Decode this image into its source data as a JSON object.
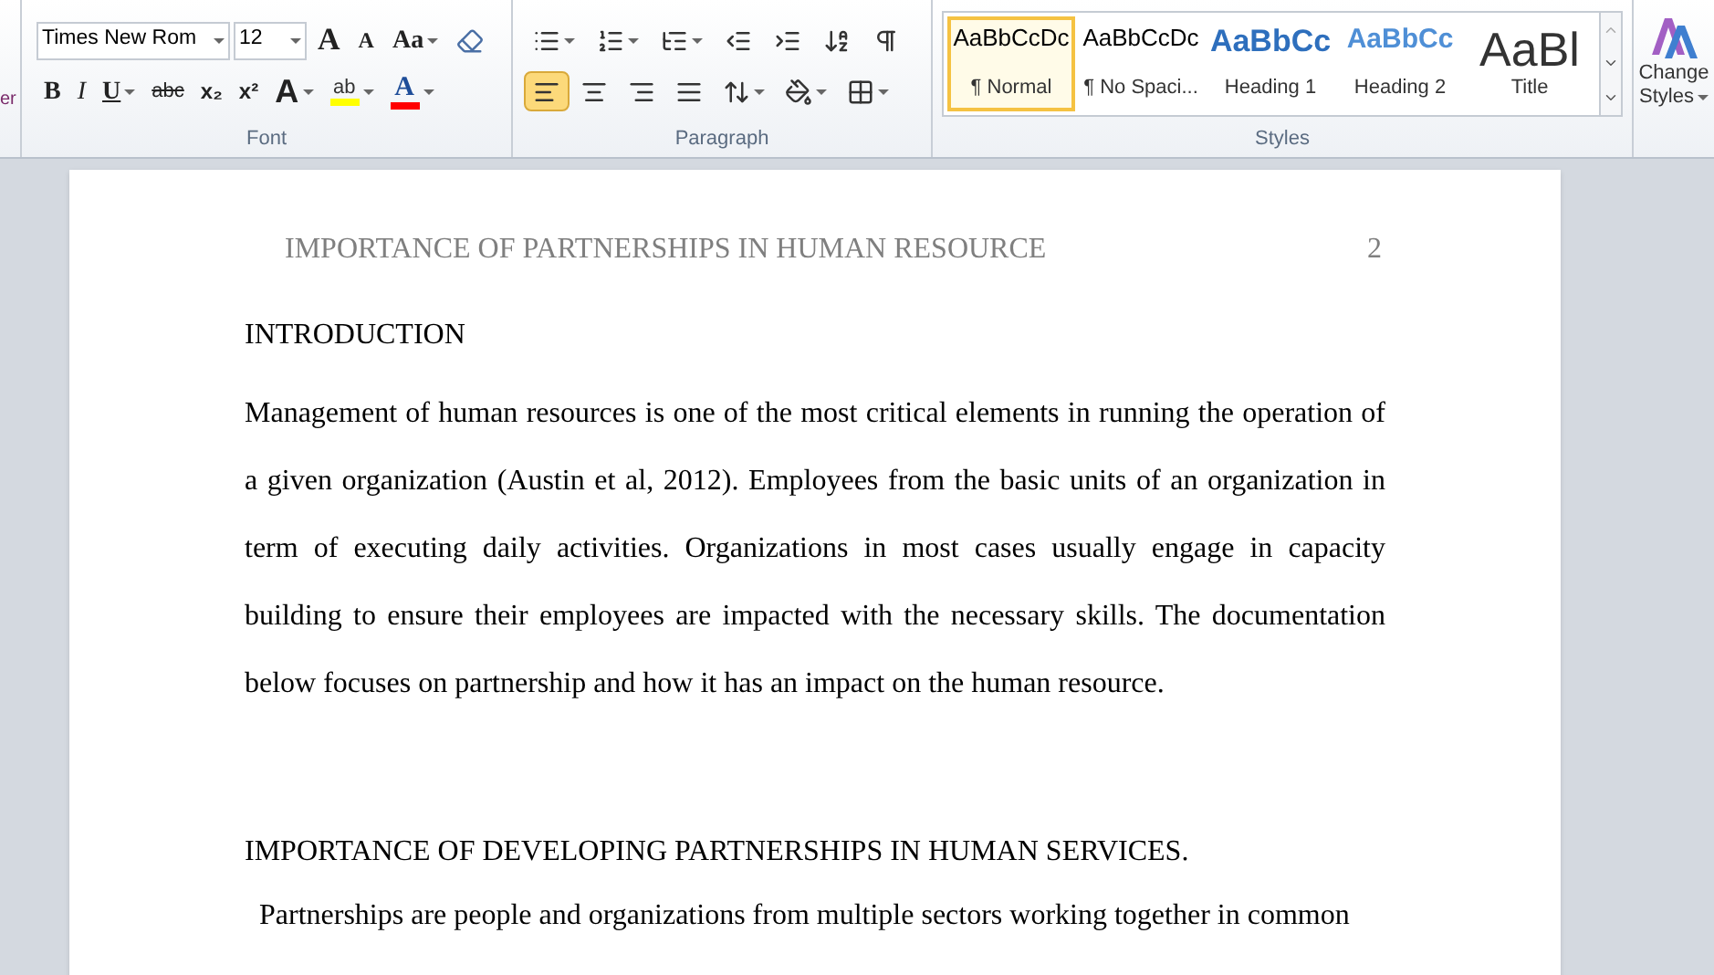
{
  "ribbon": {
    "clipped_label": "er",
    "font": {
      "label": "Font",
      "font_name": "Times New Rom",
      "font_size": "12",
      "row1": [
        {
          "kind": "grow",
          "label": "A"
        },
        {
          "kind": "shrink",
          "label": "A"
        },
        {
          "kind": "case",
          "label": "Aa"
        },
        {
          "kind": "clear"
        }
      ],
      "row2": [
        {
          "kind": "bold",
          "label": "B"
        },
        {
          "kind": "italic",
          "label": "I"
        },
        {
          "kind": "underline",
          "label": "U"
        },
        {
          "kind": "strike",
          "label": "abc"
        },
        {
          "kind": "sub",
          "label": "x₂"
        },
        {
          "kind": "sup",
          "label": "x²"
        },
        {
          "kind": "effects",
          "label": "A"
        },
        {
          "kind": "highlight",
          "label": "ab",
          "color": "#ffff00"
        },
        {
          "kind": "fontcolor",
          "label": "A",
          "color": "#ff0000"
        }
      ]
    },
    "paragraph": {
      "label": "Paragraph",
      "row1": [
        {
          "kind": "bullets"
        },
        {
          "kind": "numbering"
        },
        {
          "kind": "multilevel"
        },
        {
          "kind": "outdent"
        },
        {
          "kind": "indent"
        },
        {
          "kind": "sort"
        },
        {
          "kind": "pilcrow"
        }
      ],
      "row2": [
        {
          "kind": "align-left",
          "selected": true
        },
        {
          "kind": "align-center",
          "selected": false
        },
        {
          "kind": "align-right",
          "selected": false
        },
        {
          "kind": "justify",
          "selected": false
        },
        {
          "kind": "spacing"
        },
        {
          "kind": "shading"
        },
        {
          "kind": "borders"
        }
      ]
    },
    "styles": {
      "label": "Styles",
      "items": [
        {
          "kind": "normal",
          "preview": "AaBbCcDc",
          "name": "¶ Normal",
          "selected": true
        },
        {
          "kind": "normal",
          "preview": "AaBbCcDc",
          "name": "¶ No Spaci...",
          "selected": false
        },
        {
          "kind": "heading1",
          "preview": "AaBbCc",
          "name": "Heading 1",
          "selected": false
        },
        {
          "kind": "heading2",
          "preview": "AaBbCc",
          "name": "Heading 2",
          "selected": false
        },
        {
          "kind": "title",
          "preview": "AaBl",
          "name": "Title",
          "selected": false
        }
      ]
    },
    "change_styles": {
      "line1": "Change",
      "line2": "Styles"
    }
  },
  "document": {
    "header": "IMPORTANCE OF PARTNERSHIPS IN HUMAN RESOURCE",
    "page_number": "2",
    "blocks": [
      {
        "kind": "heading",
        "text": "INTRODUCTION"
      },
      {
        "kind": "paragraph",
        "text": "Management of human resources is one of the most critical elements in running the operation of a given organization (Austin et al, 2012). Employees from the basic units of an organization in term of executing daily activities. Organizations in most cases usually engage in capacity building to ensure their employees are impacted with the necessary skills. The documentation below focuses on partnership and how it has an impact on the human resource."
      },
      {
        "kind": "heading",
        "text": "IMPORTANCE OF DEVELOPING PARTNERSHIPS IN HUMAN SERVICES."
      },
      {
        "kind": "paragraph",
        "text": "Partnerships are people and organizations from multiple sectors working together in common"
      }
    ]
  }
}
